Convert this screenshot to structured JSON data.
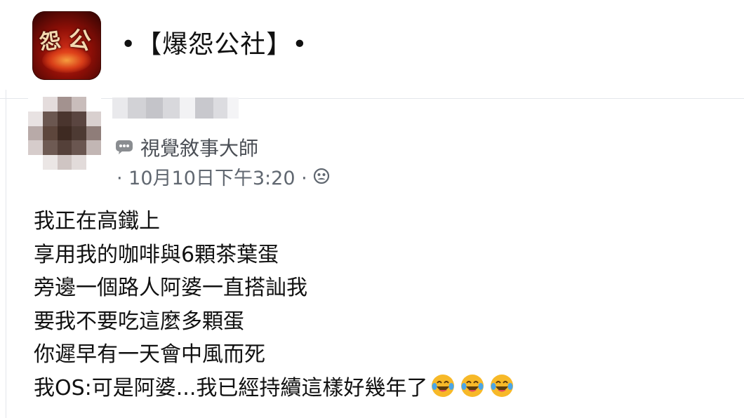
{
  "group": {
    "title": "•【爆怨公社】•",
    "logo_text_left": "怨",
    "logo_text_right": "公"
  },
  "post": {
    "group_label": "視覺敘事大師",
    "timestamp": "· 10月10日下午3:20 ·",
    "icons": {
      "group_badge": "speech-bubble-icon",
      "audience": "group-audience-icon",
      "reaction": "laughing-crying-emoji"
    },
    "lines": [
      "我正在高鐵上",
      "享用我的咖啡與6顆茶葉蛋",
      "旁邊一個路人阿婆一直搭訕我",
      "要我不要吃這麼多顆蛋",
      "你遲早有一天會中風而死",
      "我OS:可是阿婆...我已經持續這樣好幾年了"
    ],
    "emoji_count": 3
  },
  "colors": {
    "text": "#1c1e21",
    "secondary_text": "#606770",
    "divider": "#e4e6eb",
    "logo_red": "#d8321a"
  }
}
